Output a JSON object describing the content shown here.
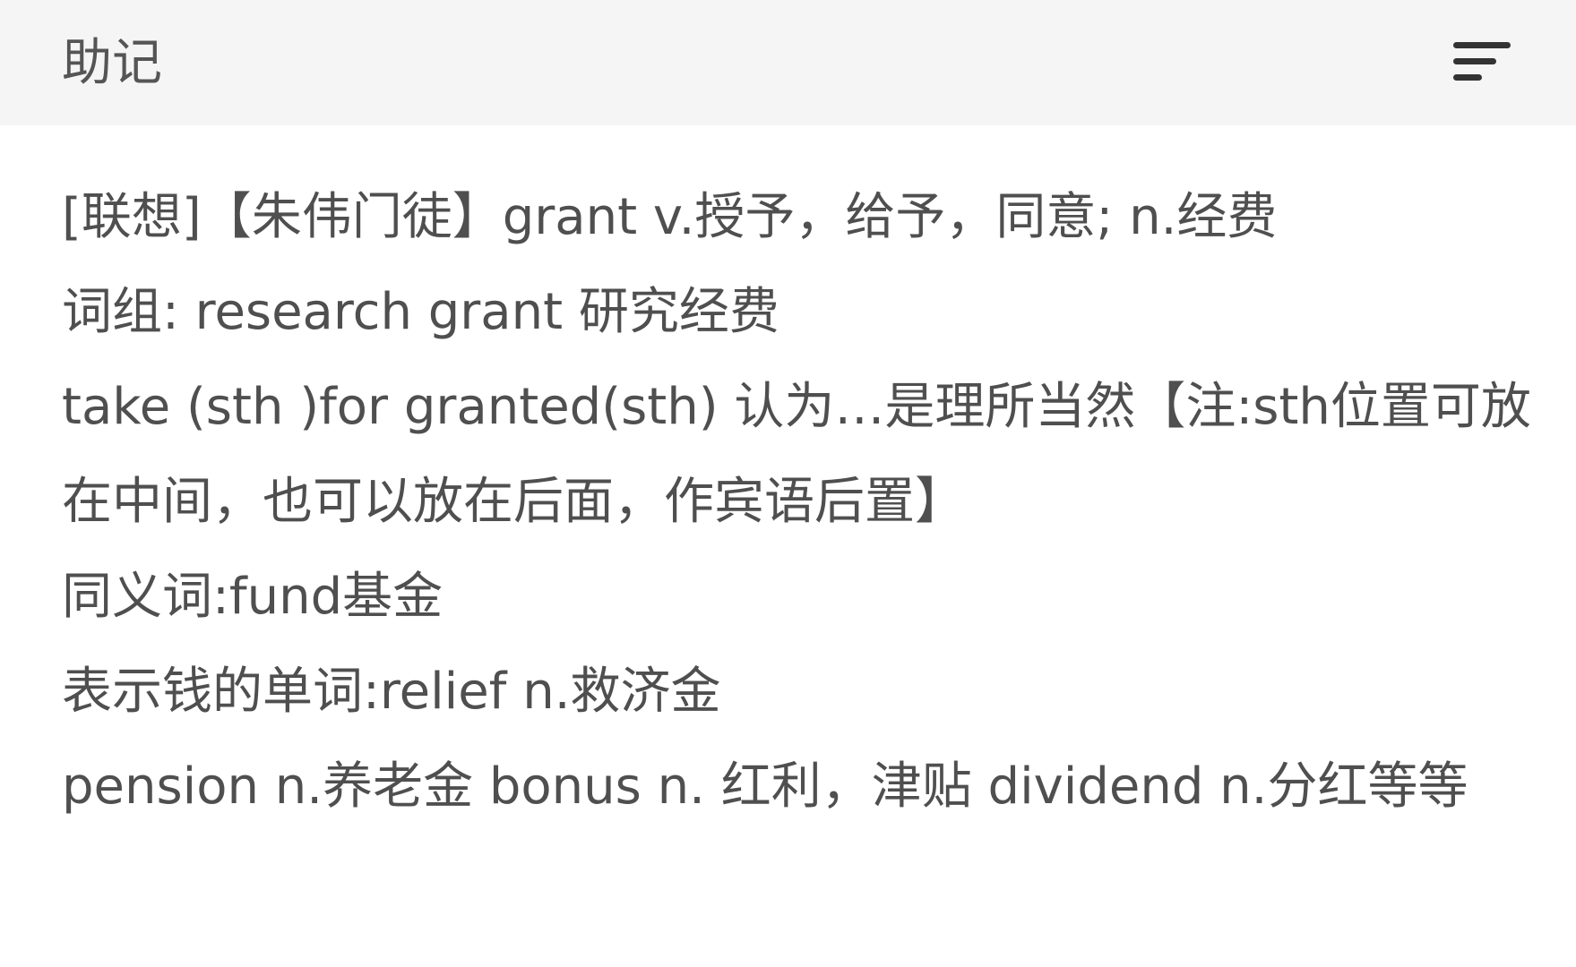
{
  "header": {
    "title": "助记",
    "sort_icon": "sort-lines-icon"
  },
  "content": {
    "lines": [
      "[联想]【朱伟门徒】grant v.授予，给予，同意; n.经费",
      "词组: research grant 研究经费",
      "take (sth )for granted(sth) 认为…是理所当然【注:sth位置可放在中间，也可以放在后面，作宾语后置】",
      "同义词:fund基金",
      "表示钱的单词:relief n.救济金",
      "pension n.养老金 bonus n. 红利，津贴 dividend n.分红等等"
    ]
  },
  "colors": {
    "header_background": "#f5f5f5",
    "text": "#4f4f4f",
    "icon": "#333333"
  }
}
